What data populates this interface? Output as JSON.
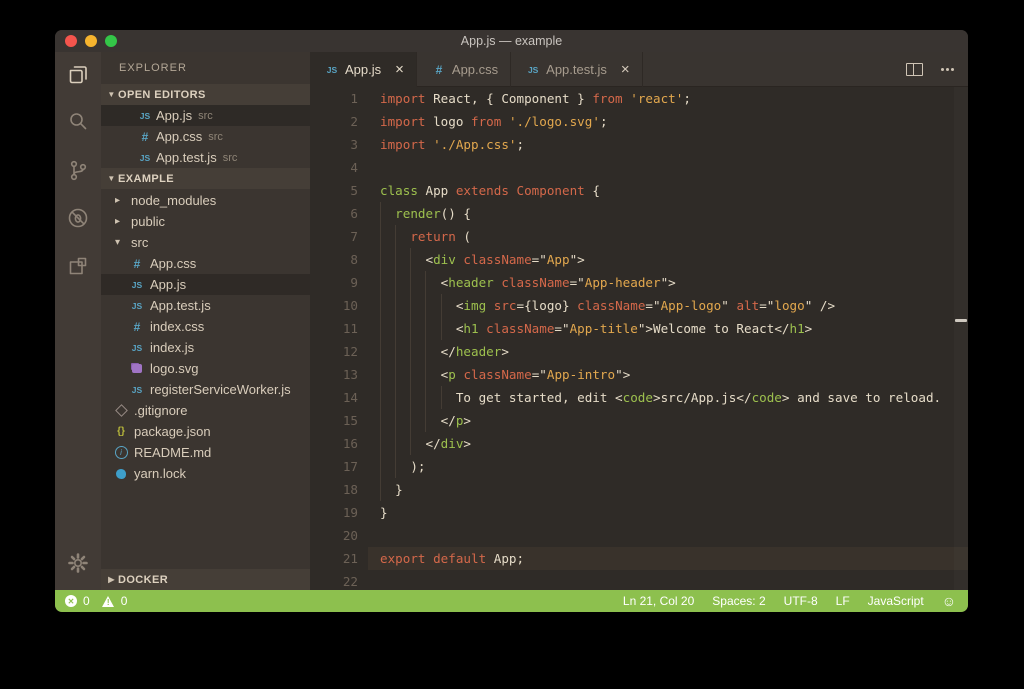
{
  "window": {
    "title": "App.js — example"
  },
  "activity_bar": {
    "items": [
      {
        "icon": "files-icon",
        "active": true
      },
      {
        "icon": "search-icon",
        "active": false
      },
      {
        "icon": "source-control-icon",
        "active": false
      },
      {
        "icon": "debug-icon",
        "active": false
      },
      {
        "icon": "extensions-icon",
        "active": false
      }
    ],
    "settings_icon": "gear-icon"
  },
  "sidebar": {
    "title": "EXPLORER",
    "open_editors": {
      "header": "OPEN EDITORS",
      "items": [
        {
          "icon": "js",
          "label": "App.js",
          "detail": "src",
          "selected": true
        },
        {
          "icon": "css",
          "label": "App.css",
          "detail": "src",
          "selected": false
        },
        {
          "icon": "js",
          "label": "App.test.js",
          "detail": "src",
          "selected": false
        }
      ]
    },
    "project": {
      "header": "EXAMPLE",
      "tree": [
        {
          "type": "folder",
          "label": "node_modules",
          "indent": 0,
          "expanded": false
        },
        {
          "type": "folder",
          "label": "public",
          "indent": 0,
          "expanded": false
        },
        {
          "type": "folder",
          "label": "src",
          "indent": 0,
          "expanded": true
        },
        {
          "type": "file",
          "icon": "css",
          "label": "App.css",
          "indent": 1
        },
        {
          "type": "file",
          "icon": "js",
          "label": "App.js",
          "indent": 1,
          "selected": true
        },
        {
          "type": "file",
          "icon": "js",
          "label": "App.test.js",
          "indent": 1
        },
        {
          "type": "file",
          "icon": "css",
          "label": "index.css",
          "indent": 1
        },
        {
          "type": "file",
          "icon": "js",
          "label": "index.js",
          "indent": 1
        },
        {
          "type": "file",
          "icon": "svg",
          "label": "logo.svg",
          "indent": 1
        },
        {
          "type": "file",
          "icon": "js",
          "label": "registerServiceWorker.js",
          "indent": 1
        },
        {
          "type": "file",
          "icon": "git",
          "label": ".gitignore",
          "indent": 0
        },
        {
          "type": "file",
          "icon": "json",
          "label": "package.json",
          "indent": 0
        },
        {
          "type": "file",
          "icon": "info",
          "label": "README.md",
          "indent": 0
        },
        {
          "type": "file",
          "icon": "yarn",
          "label": "yarn.lock",
          "indent": 0
        }
      ]
    },
    "docker": {
      "header": "DOCKER",
      "expanded": false
    }
  },
  "tabs": [
    {
      "icon": "js",
      "label": "App.js",
      "active": true,
      "close": true
    },
    {
      "icon": "css",
      "label": "App.css",
      "active": false,
      "close": false
    },
    {
      "icon": "js",
      "label": "App.test.js",
      "active": false,
      "close": true
    }
  ],
  "editor": {
    "active_line": 21,
    "lines": [
      {
        "ind": 0,
        "t": [
          [
            "k",
            "import"
          ],
          [
            "p",
            " React, { Component } "
          ],
          [
            "k",
            "from"
          ],
          [
            "p",
            " "
          ],
          [
            "s",
            "'react'"
          ],
          [
            "p",
            ";"
          ]
        ]
      },
      {
        "ind": 0,
        "t": [
          [
            "k",
            "import"
          ],
          [
            "p",
            " logo "
          ],
          [
            "k",
            "from"
          ],
          [
            "p",
            " "
          ],
          [
            "s",
            "'./logo.svg'"
          ],
          [
            "p",
            ";"
          ]
        ]
      },
      {
        "ind": 0,
        "t": [
          [
            "k",
            "import"
          ],
          [
            "p",
            " "
          ],
          [
            "s",
            "'./App.css'"
          ],
          [
            "p",
            ";"
          ]
        ]
      },
      {
        "ind": 0,
        "t": []
      },
      {
        "ind": 0,
        "t": [
          [
            "t",
            "class"
          ],
          [
            "p",
            " App "
          ],
          [
            "k",
            "extends"
          ],
          [
            "p",
            " "
          ],
          [
            "k",
            "Component"
          ],
          [
            "p",
            " {"
          ]
        ]
      },
      {
        "ind": 2,
        "t": [
          [
            "p",
            "  "
          ],
          [
            "t",
            "render"
          ],
          [
            "p",
            "() {"
          ]
        ]
      },
      {
        "ind": 4,
        "t": [
          [
            "p",
            "    "
          ],
          [
            "k",
            "return"
          ],
          [
            "p",
            " ("
          ]
        ]
      },
      {
        "ind": 6,
        "t": [
          [
            "p",
            "      <"
          ],
          [
            "t",
            "div"
          ],
          [
            "p",
            " "
          ],
          [
            "a",
            "className"
          ],
          [
            "p",
            "=\""
          ],
          [
            "s",
            "App"
          ],
          [
            "p",
            "\">"
          ]
        ]
      },
      {
        "ind": 8,
        "t": [
          [
            "p",
            "        <"
          ],
          [
            "t",
            "header"
          ],
          [
            "p",
            " "
          ],
          [
            "a",
            "className"
          ],
          [
            "p",
            "=\""
          ],
          [
            "s",
            "App-header"
          ],
          [
            "p",
            "\">"
          ]
        ]
      },
      {
        "ind": 10,
        "t": [
          [
            "p",
            "          <"
          ],
          [
            "t",
            "img"
          ],
          [
            "p",
            " "
          ],
          [
            "a",
            "src"
          ],
          [
            "p",
            "={logo} "
          ],
          [
            "a",
            "className"
          ],
          [
            "p",
            "=\""
          ],
          [
            "s",
            "App-logo"
          ],
          [
            "p",
            "\" "
          ],
          [
            "a",
            "alt"
          ],
          [
            "p",
            "=\""
          ],
          [
            "s",
            "logo"
          ],
          [
            "p",
            "\" />"
          ]
        ]
      },
      {
        "ind": 10,
        "t": [
          [
            "p",
            "          <"
          ],
          [
            "t",
            "h1"
          ],
          [
            "p",
            " "
          ],
          [
            "a",
            "className"
          ],
          [
            "p",
            "=\""
          ],
          [
            "s",
            "App-title"
          ],
          [
            "p",
            "\">Welcome to React</"
          ],
          [
            "t",
            "h1"
          ],
          [
            "p",
            ">"
          ]
        ]
      },
      {
        "ind": 8,
        "t": [
          [
            "p",
            "        </"
          ],
          [
            "t",
            "header"
          ],
          [
            "p",
            ">"
          ]
        ]
      },
      {
        "ind": 8,
        "t": [
          [
            "p",
            "        <"
          ],
          [
            "t",
            "p"
          ],
          [
            "p",
            " "
          ],
          [
            "a",
            "className"
          ],
          [
            "p",
            "=\""
          ],
          [
            "s",
            "App-intro"
          ],
          [
            "p",
            "\">"
          ]
        ]
      },
      {
        "ind": 10,
        "t": [
          [
            "p",
            "          To get started, edit <"
          ],
          [
            "t",
            "code"
          ],
          [
            "p",
            ">src/App.js</"
          ],
          [
            "t",
            "code"
          ],
          [
            "p",
            "> and save to reload."
          ]
        ]
      },
      {
        "ind": 8,
        "t": [
          [
            "p",
            "        </"
          ],
          [
            "t",
            "p"
          ],
          [
            "p",
            ">"
          ]
        ]
      },
      {
        "ind": 6,
        "t": [
          [
            "p",
            "      </"
          ],
          [
            "t",
            "div"
          ],
          [
            "p",
            ">"
          ]
        ]
      },
      {
        "ind": 4,
        "t": [
          [
            "p",
            "    );"
          ]
        ]
      },
      {
        "ind": 2,
        "t": [
          [
            "p",
            "  }"
          ]
        ]
      },
      {
        "ind": 0,
        "t": [
          [
            "p",
            "}"
          ]
        ]
      },
      {
        "ind": 0,
        "t": []
      },
      {
        "ind": 0,
        "t": [
          [
            "k",
            "export"
          ],
          [
            "p",
            " "
          ],
          [
            "k",
            "default"
          ],
          [
            "p",
            " App;"
          ]
        ]
      },
      {
        "ind": 0,
        "t": []
      }
    ]
  },
  "status_bar": {
    "errors": "0",
    "warnings": "0",
    "items": [
      "Ln 21, Col 20",
      "Spaces: 2",
      "UTF-8",
      "LF",
      "JavaScript"
    ]
  },
  "colors": {
    "status_green": "#8dc04e",
    "file_icon_blue": "#59a5c5",
    "svg_icon_purple": "#a074c4",
    "json_icon_yellow": "#b7b73b",
    "keyword": "#d4684a",
    "tag_green": "#9dc04e",
    "string_orange": "#e3a84e",
    "plain_cream": "#e6dcc8"
  }
}
